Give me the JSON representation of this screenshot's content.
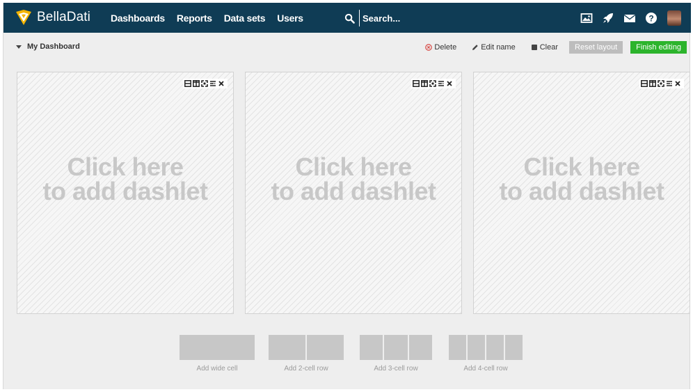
{
  "app": {
    "name": "BellaDati"
  },
  "nav": {
    "items": [
      "Dashboards",
      "Reports",
      "Data sets",
      "Users"
    ]
  },
  "search": {
    "placeholder": "Search..."
  },
  "header_icons": [
    "image-icon",
    "rocket-icon",
    "mail-icon",
    "help-icon",
    "user-avatar"
  ],
  "dashboard": {
    "title": "My Dashboard"
  },
  "actions": {
    "delete": "Delete",
    "edit_name": "Edit name",
    "clear": "Clear",
    "reset_layout": "Reset layout",
    "finish_editing": "Finish editing"
  },
  "cells": [
    {
      "line1": "Click here",
      "line2": "to add dashlet"
    },
    {
      "line1": "Click here",
      "line2": "to add dashlet"
    },
    {
      "line1": "Click here",
      "line2": "to add dashlet"
    }
  ],
  "cell_tools": [
    "rows-icon",
    "columns-icon",
    "expand-icon",
    "split-icon",
    "close-icon"
  ],
  "adders": {
    "wide": "Add wide cell",
    "two": "Add 2-cell row",
    "three": "Add 3-cell row",
    "four": "Add 4-cell row"
  },
  "colors": {
    "topbar": "#0f3c55",
    "finish_button": "#2cb42c",
    "reset_button": "#bdbdbd",
    "delete_icon": "#d9534f"
  }
}
